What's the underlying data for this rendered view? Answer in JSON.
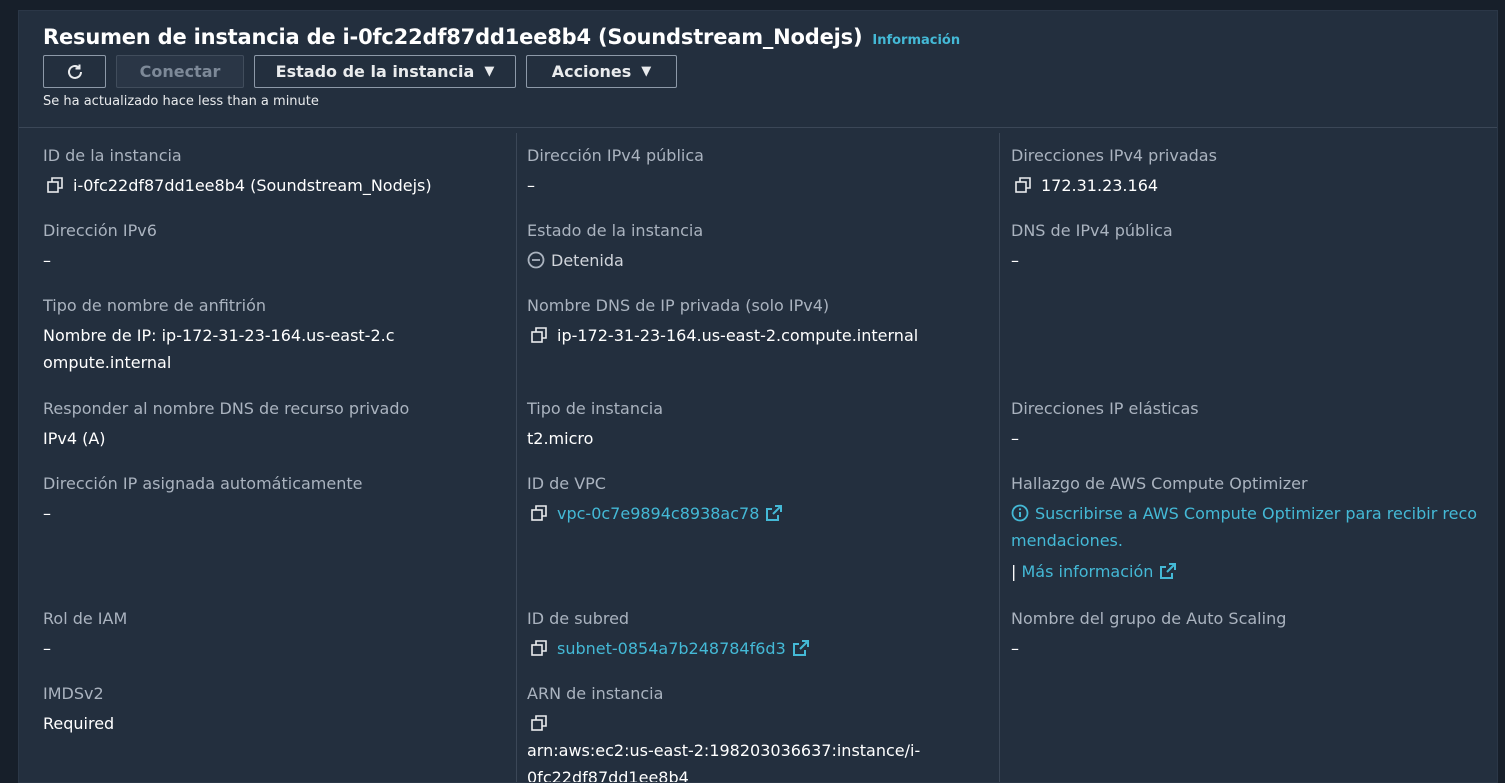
{
  "header": {
    "title": "Resumen de instancia de i-0fc22df87dd1ee8b4 (Soundstream_Nodejs)",
    "info_link": "Información",
    "connect_label": "Conectar",
    "instance_state_label": "Estado de la instancia",
    "actions_label": "Acciones",
    "updated_text": "Se ha actualizado hace less than a minute"
  },
  "col1": {
    "instance_id_label": "ID de la instancia",
    "instance_id_value": "i-0fc22df87dd1ee8b4 (Soundstream_Nodejs)",
    "ipv6_label": "Dirección IPv6",
    "ipv6_value": "–",
    "hostname_type_label": "Tipo de nombre de anfitrión",
    "hostname_type_value": "Nombre de IP: ip-172-31-23-164.us-east-2.compute.internal",
    "answer_dns_label": "Responder al nombre DNS de recurso privado",
    "answer_dns_value": "IPv4 (A)",
    "auto_ip_label": "Dirección IP asignada automáticamente",
    "auto_ip_value": "–",
    "iam_label": "Rol de IAM",
    "iam_value": "–",
    "imds_label": "IMDSv2",
    "imds_value": "Required"
  },
  "col2": {
    "public_ipv4_label": "Dirección IPv4 pública",
    "public_ipv4_value": "–",
    "state_label": "Estado de la instancia",
    "state_value": "Detenida",
    "private_dns_label": "Nombre DNS de IP privada (solo IPv4)",
    "private_dns_value": "ip-172-31-23-164.us-east-2.compute.internal",
    "instance_type_label": "Tipo de instancia",
    "instance_type_value": "t2.micro",
    "vpc_label": "ID de VPC",
    "vpc_value": "vpc-0c7e9894c8938ac78",
    "subnet_label": "ID de subred",
    "subnet_value": "subnet-0854a7b248784f6d3",
    "arn_label": "ARN de instancia",
    "arn_value": "arn:aws:ec2:us-east-2:198203036637:instance/i-0fc22df87dd1ee8b4"
  },
  "col3": {
    "private_ipv4_label": "Direcciones IPv4 privadas",
    "private_ipv4_value": "172.31.23.164",
    "public_dns_label": "DNS de IPv4 pública",
    "public_dns_value": "–",
    "elastic_ip_label": "Direcciones IP elásticas",
    "elastic_ip_value": "–",
    "optimizer_label": "Hallazgo de AWS Compute Optimizer",
    "optimizer_link": "Suscribirse a AWS Compute Optimizer para recibir recomendaciones.",
    "optimizer_more_sep": "|",
    "optimizer_more": "Más información",
    "asg_label": "Nombre del grupo de Auto Scaling",
    "asg_value": "–"
  },
  "colors": {
    "background": "#232f3e",
    "link": "#44b9d6",
    "label": "#aab3bf",
    "value": "#ffffff"
  }
}
